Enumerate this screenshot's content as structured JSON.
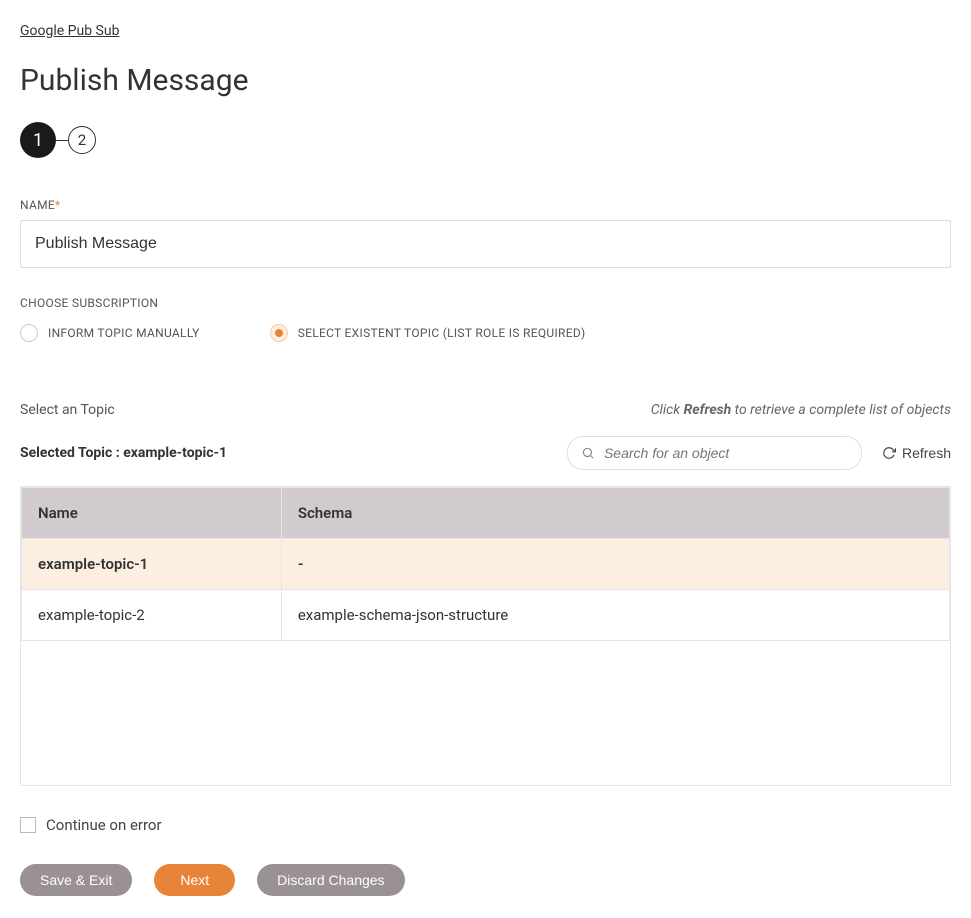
{
  "breadcrumb": "Google Pub Sub",
  "page_title": "Publish Message",
  "stepper": {
    "step1": "1",
    "step2": "2"
  },
  "form": {
    "name_label": "NAME",
    "name_value": "Publish Message",
    "choose_subscription_label": "CHOOSE SUBSCRIPTION",
    "radio_options": {
      "inform_manually": "INFORM TOPIC MANUALLY",
      "select_existent": "SELECT EXISTENT TOPIC (LIST ROLE IS REQUIRED)"
    }
  },
  "topic_section": {
    "select_label": "Select an Topic",
    "refresh_hint_prefix": "Click ",
    "refresh_hint_bold": "Refresh",
    "refresh_hint_suffix": " to retrieve a complete list of objects",
    "selected_topic_label": "Selected Topic : example-topic-1",
    "search_placeholder": "Search for an object",
    "refresh_button": "Refresh"
  },
  "table": {
    "headers": {
      "name": "Name",
      "schema": "Schema"
    },
    "rows": [
      {
        "name": "example-topic-1",
        "schema": "-",
        "selected": true
      },
      {
        "name": "example-topic-2",
        "schema": "example-schema-json-structure",
        "selected": false
      }
    ]
  },
  "continue_on_error": "Continue on error",
  "buttons": {
    "save_exit": "Save & Exit",
    "next": "Next",
    "discard": "Discard Changes"
  }
}
